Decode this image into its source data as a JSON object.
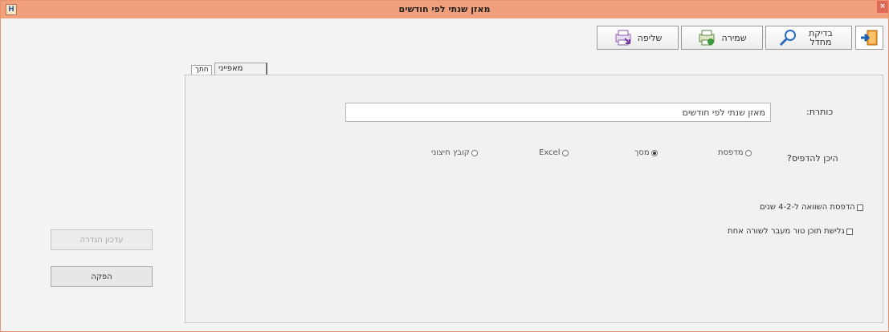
{
  "window": {
    "title": "מאזן שנתי לפי חודשים",
    "app_icon_glyph": "H",
    "close_glyph": "×",
    "accent_color": "#f0a07c"
  },
  "toolbar": {
    "exit_icon": "exit-door-icon",
    "check_label": "בדיקת\nמחדל",
    "check_icon": "magnifier-icon",
    "save_label": "שמירה",
    "save_icon": "save-printer-icon",
    "load_label": "שליפה",
    "load_icon": "load-printer-icon"
  },
  "tabs": {
    "print_props": "מאפייני הדפסה",
    "margin": "חתך"
  },
  "form": {
    "title_label": "כותרת:",
    "title_value": "מאזן שנתי לפי חודשים",
    "where_label": "היכן להדפיס?",
    "options": {
      "printer": "מדפסת",
      "screen": "מסך",
      "excel": "Excel",
      "external": "קובץ חיצוני"
    },
    "selected_option": "screen",
    "compare_label": "הדפסת השוואה ל-4-2 שנים",
    "wrap_label": "גלישת תוכן טור מעבר לשורה אחת"
  },
  "side": {
    "update_label": "עדכון הגדרה",
    "produce_label": "הפקה"
  }
}
